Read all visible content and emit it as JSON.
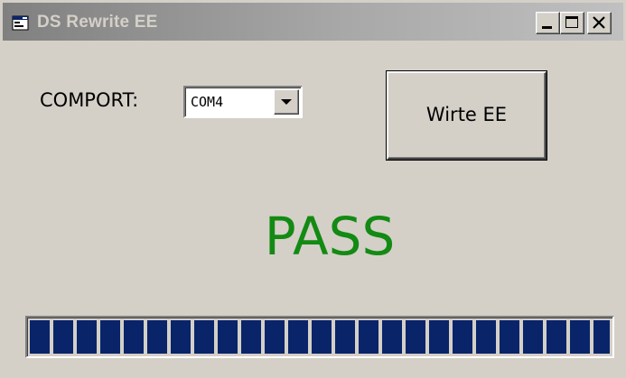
{
  "window": {
    "title": "DS Rewrite EE",
    "icons": {
      "app": "app-window-icon",
      "minimize": "minimize-icon",
      "maximize": "maximize-icon",
      "close": "close-icon"
    }
  },
  "comport": {
    "label": "COMPORT:",
    "selected": "COM4",
    "dropdown_icon": "chevron-down-icon"
  },
  "write_button": {
    "label": "Wirte EE"
  },
  "status": {
    "text": "PASS",
    "color": "#138a13"
  },
  "progress": {
    "value_percent": 100,
    "fill_color": "#0a246a"
  },
  "colors": {
    "window_bg": "#d4d0c8",
    "titlebar_start": "#808080",
    "titlebar_end": "#c0c0c0"
  }
}
